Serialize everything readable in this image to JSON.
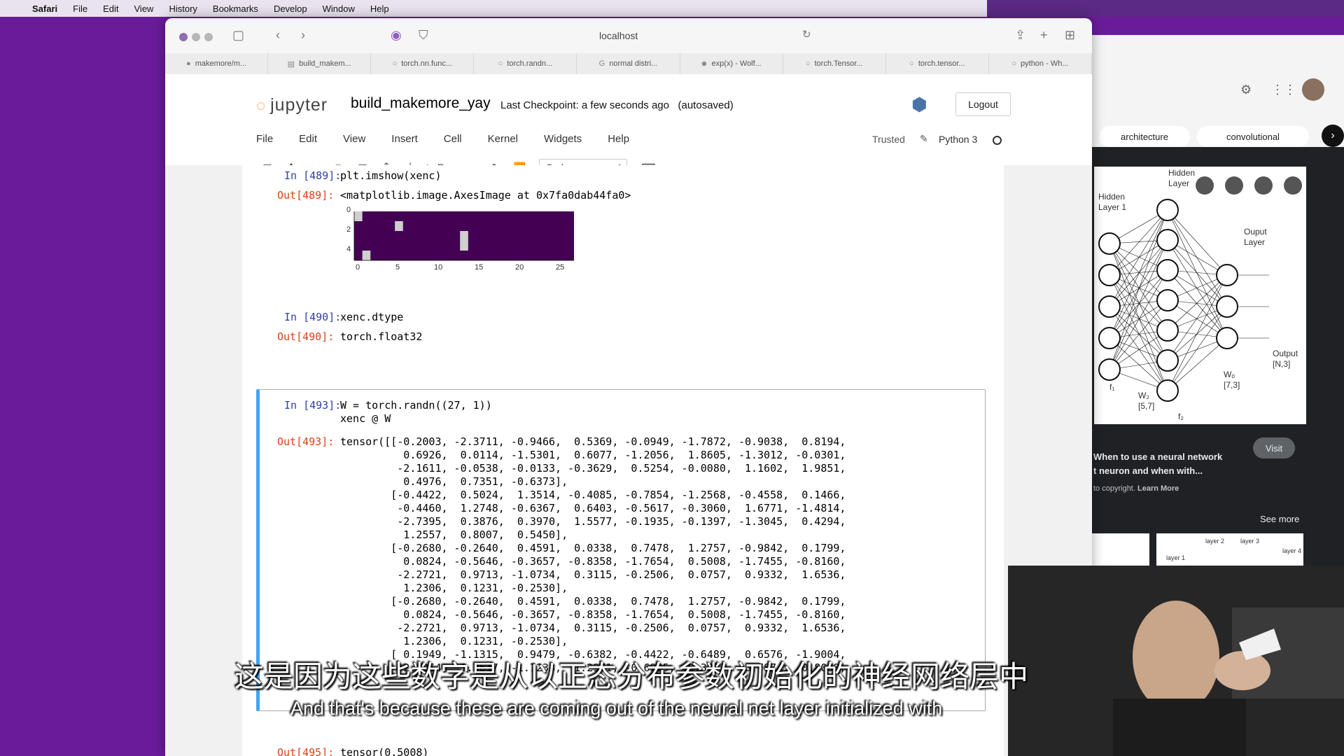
{
  "menubar": {
    "items": [
      "Safari",
      "File",
      "Edit",
      "View",
      "History",
      "Bookmarks",
      "Develop",
      "Window",
      "Help"
    ]
  },
  "browser": {
    "address": "localhost",
    "tabs": [
      {
        "label": "makemore/m...",
        "icon": "github-icon"
      },
      {
        "label": "build_makem...",
        "icon": "notebook-icon"
      },
      {
        "label": "torch.nn.func...",
        "icon": "pytorch-icon"
      },
      {
        "label": "torch.randn...",
        "icon": "pytorch-icon"
      },
      {
        "label": "normal distri...",
        "icon": "google-icon"
      },
      {
        "label": "exp(x) - Wolf...",
        "icon": "wolfram-icon"
      },
      {
        "label": "torch.Tensor...",
        "icon": "pytorch-icon"
      },
      {
        "label": "torch.tensor...",
        "icon": "pytorch-icon"
      },
      {
        "label": "python - Wh...",
        "icon": "pytorch-icon"
      }
    ]
  },
  "jupyter": {
    "logo_text": "jupyter",
    "notebook_name": "build_makemore_yay",
    "checkpoint": "Last Checkpoint: a few seconds ago",
    "autosaved": "(autosaved)",
    "logout": "Logout",
    "menu": [
      "File",
      "Edit",
      "View",
      "Insert",
      "Cell",
      "Kernel",
      "Widgets",
      "Help"
    ],
    "trusted": "Trusted",
    "kernel": "Python 3",
    "run_label": "Run",
    "cell_type": "Code"
  },
  "cells": {
    "c489": {
      "in_prompt": "In [489]:",
      "code": "plt.imshow(xenc)",
      "out_prompt": "Out[489]:",
      "output": "<matplotlib.image.AxesImage at 0x7fa0dab44fa0>",
      "yticks": [
        "0",
        "2",
        "4"
      ],
      "xticks": [
        "0",
        "5",
        "10",
        "15",
        "20",
        "25"
      ]
    },
    "c490": {
      "in_prompt": "In [490]:",
      "code": "xenc.dtype",
      "out_prompt": "Out[490]:",
      "output": "torch.float32"
    },
    "c493": {
      "in_prompt": "In [493]:",
      "code_line1": "W = torch.randn((27, 1))",
      "code_line2": "xenc @ W",
      "out_prompt": "Out[493]:",
      "output": "tensor([[-0.2003, -2.3711, -0.9466,  0.5369, -0.0949, -1.7872, -0.9038,  0.8194,\n          0.6926,  0.0114, -1.5301,  0.6077, -1.2056,  1.8605, -1.3012, -0.0301,\n         -2.1611, -0.0538, -0.0133, -0.3629,  0.5254, -0.0080,  1.1602,  1.9851,\n          0.4976,  0.7351, -0.6373],\n        [-0.4422,  0.5024,  1.3514, -0.4085, -0.7854, -1.2568, -0.4558,  0.1466,\n         -0.4460,  1.2748, -0.6367,  0.6403, -0.5617, -0.3060,  1.6771, -1.4814,\n         -2.7395,  0.3876,  0.3970,  1.5577, -0.1935, -0.1397, -1.3045,  0.4294,\n          1.2557,  0.8007,  0.5450],\n        [-0.2680, -0.2640,  0.4591,  0.0338,  0.7478,  1.2757, -0.9842,  0.1799,\n          0.0824, -0.5646, -0.3657, -0.8358, -1.7654,  0.5008, -1.7455, -0.8160,\n         -2.2721,  0.9713, -1.0734,  0.3115, -0.2506,  0.0757,  0.9332,  1.6536,\n          1.2306,  0.1231, -0.2530],\n        [-0.2680, -0.2640,  0.4591,  0.0338,  0.7478,  1.2757, -0.9842,  0.1799,\n          0.0824, -0.5646, -0.3657, -0.8358, -1.7654,  0.5008, -1.7455, -0.8160,\n         -2.2721,  0.9713, -1.0734,  0.3115, -0.2506,  0.0757,  0.9332,  1.6536,\n          1.2306,  0.1231, -0.2530],\n        [ 0.1949, -1.1315,  0.9479, -0.6382, -0.4422, -0.6489,  0.6576, -1.9004,\n          2.0254,  1.2617, -1.7238,  1.2971, -0.6925, -0.3873,  0.7874, -0.8088,"
    },
    "c495": {
      "out_prompt": "Out[495]:",
      "output": "tensor(0.5008)"
    }
  },
  "side_panel": {
    "chip1": "architecture",
    "chip2": "convolutional",
    "diagram_labels": {
      "hidden1": "Hidden\nLayer 1",
      "hidden2": "Hidden\nLayer",
      "output_layer": "Ouput\nLayer",
      "output": "Output\n[N,3]",
      "w2": "W₂\n[5,7]",
      "wo": "Wₒ\n[7,3]",
      "f1": "f₁",
      "f2": "f₂"
    },
    "card_title": "When to use a neural network",
    "card_title2": "t neuron and when with...",
    "copyright": "to copyright.",
    "learn_more": "Learn More",
    "visit": "Visit",
    "see_more": "See more",
    "thumb_labels": [
      "layer 2",
      "layer 3",
      "layer 4",
      "layer 1"
    ]
  },
  "subtitles": {
    "chinese": "这是因为这些数字是从以正态分布参数初始化的神经网络层中",
    "english": "And that's because these are coming out of the neural net layer initialized with"
  },
  "colors": {
    "viridis_dark": "#440154",
    "onehot": "#cfcfcf",
    "selected_cell": "#42a5f5"
  }
}
